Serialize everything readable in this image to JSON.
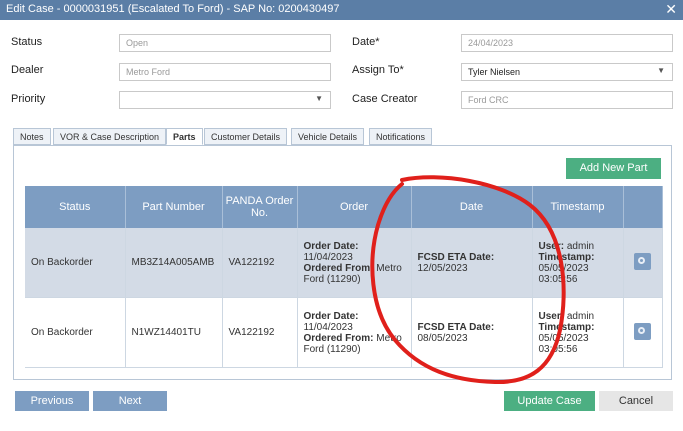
{
  "window": {
    "title": "Edit Case - 0000031951 (Escalated To Ford) - SAP No: 0200430497",
    "close_label": "✕"
  },
  "form": {
    "status_label": "Status",
    "status_value": "Open",
    "dealer_label": "Dealer",
    "dealer_value": "Metro Ford",
    "priority_label": "Priority",
    "priority_value": "",
    "date_label": "Date*",
    "date_value": "24/04/2023",
    "assign_label": "Assign To*",
    "assign_value": "Tyler Nielsen",
    "creator_label": "Case Creator",
    "creator_value": "Ford CRC"
  },
  "tabs": [
    "Notes",
    "VOR & Case Description",
    "Parts",
    "Customer Details",
    "Vehicle Details",
    "Notifications"
  ],
  "active_tab": "Parts",
  "add_part_label": "Add New Part",
  "table": {
    "headers": [
      "Status",
      "Part Number",
      "PANDA Order No.",
      "Order",
      "Date",
      "Timestamp",
      ""
    ],
    "rows": [
      {
        "status": "On Backorder",
        "part_number": "MB3Z14A005AMB",
        "panda": "VA122192",
        "order_date_label": "Order Date:",
        "order_date": "11/04/2023",
        "ordered_from_label": "Ordered From:",
        "ordered_from": "Metro Ford (11290)",
        "eta_label": "FCSD ETA Date:",
        "eta": "12/05/2023",
        "user_label": "User:",
        "user": "admin",
        "ts_label": "Timestamp:",
        "ts": "05/05/2023 03:05:56"
      },
      {
        "status": "On Backorder",
        "part_number": "N1WZ14401TU",
        "panda": "VA122192",
        "order_date_label": "Order Date:",
        "order_date": "11/04/2023",
        "ordered_from_label": "Ordered From:",
        "ordered_from": "Metro Ford (11290)",
        "eta_label": "FCSD ETA Date:",
        "eta": "08/05/2023",
        "user_label": "User:",
        "user": "admin",
        "ts_label": "Timestamp:",
        "ts": "05/05/2023 03:05:56"
      }
    ]
  },
  "footer": {
    "previous": "Previous",
    "next": "Next",
    "update": "Update Case",
    "cancel": "Cancel"
  },
  "colors": {
    "header": "#5b7ea6",
    "accent_blue": "#7d9dc2",
    "accent_green": "#4caf82",
    "annotation": "#e0201b"
  },
  "icons": {
    "close": "close-icon",
    "dropdown": "chevron-down-icon",
    "row_action": "settings-icon"
  }
}
